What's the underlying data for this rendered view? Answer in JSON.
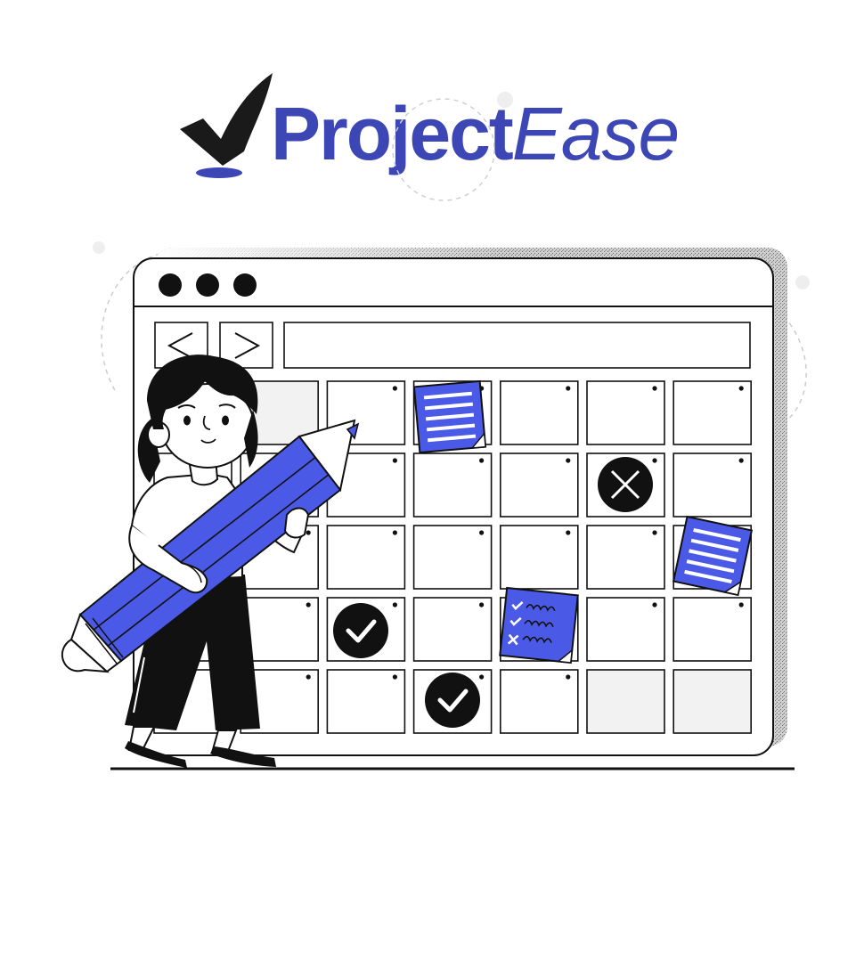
{
  "brand": {
    "name_part1": "Project",
    "name_part2": "Ease",
    "logo_icon": "checkmark-icon"
  },
  "colors": {
    "brand_blue": "#3c46b4",
    "accent_blue": "#4b5ae6",
    "ink": "#111111",
    "muted_cell": "#f2f2f2"
  },
  "browser_window": {
    "window_dots": 3,
    "back_icon": "chevron-left-icon",
    "forward_icon": "chevron-right-icon",
    "address_bar_value": ""
  },
  "calendar": {
    "rows": 5,
    "columns": 7,
    "marked_days": [
      {
        "row": 1,
        "col": 5,
        "mark": "cross-icon"
      },
      {
        "row": 3,
        "col": 2,
        "mark": "check-icon"
      },
      {
        "row": 4,
        "col": 3,
        "mark": "check-icon"
      }
    ],
    "sticky_notes": [
      {
        "row": 0,
        "col": 3,
        "type": "lined-note-icon"
      },
      {
        "row": 2,
        "col": 6,
        "type": "lined-note-icon"
      },
      {
        "row": 3,
        "col": 4,
        "type": "checklist-note-icon"
      }
    ],
    "muted_cells": [
      {
        "row": 0,
        "col": 1
      },
      {
        "row": 4,
        "col": 5
      },
      {
        "row": 4,
        "col": 6
      }
    ]
  },
  "illustration": {
    "character": "girl-holding-pencil",
    "prop": "pencil-icon"
  }
}
